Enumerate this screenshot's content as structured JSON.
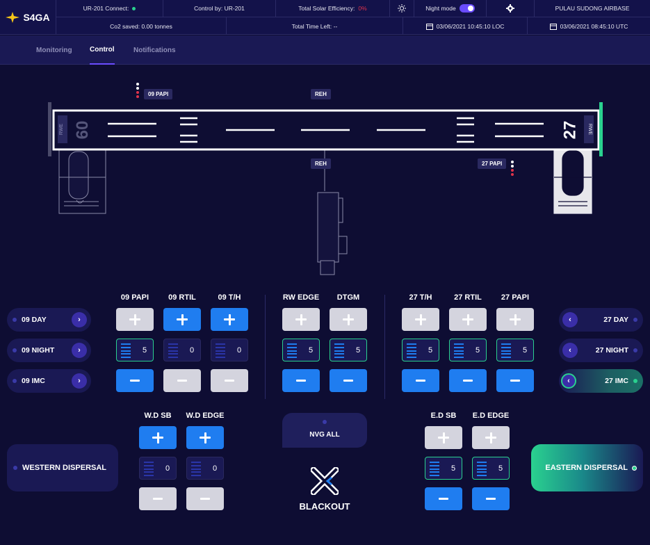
{
  "header": {
    "logo": "S4GA",
    "connect_label": "UR-201 Connect:",
    "control_by": "Control by: UR-201",
    "solar_label": "Total Solar Efficiency:",
    "solar_value": "0%",
    "night_mode_label": "Night mode",
    "airbase": "PULAU SUDONG AIRBASE",
    "co2": "Co2 saved: 0.00 tonnes",
    "time_left": "Total Time Left: --",
    "loc_time": "03/06/2021 10:45:10 LOC",
    "utc_time": "03/06/2021 08:45:10 UTC"
  },
  "tabs": [
    {
      "label": "Monitoring"
    },
    {
      "label": "Control"
    },
    {
      "label": "Notifications"
    }
  ],
  "runway": {
    "papi_09": "09 PAPI",
    "papi_27": "27 PAPI",
    "reh_top": "REH",
    "reh_bottom": "REH",
    "left_number": "09",
    "right_number": "27",
    "left_rwe": "RWE",
    "right_rwe": "RWE"
  },
  "left_modes": [
    {
      "label": "09 DAY"
    },
    {
      "label": "09 NIGHT"
    },
    {
      "label": "09 IMC"
    }
  ],
  "right_modes": [
    {
      "label": "27 DAY"
    },
    {
      "label": "27 NIGHT"
    },
    {
      "label": "27 IMC"
    }
  ],
  "groups": {
    "g09": [
      {
        "label": "09 PAPI",
        "value": "5"
      },
      {
        "label": "09 RTIL",
        "value": "0"
      },
      {
        "label": "09 T/H",
        "value": "0"
      }
    ],
    "center": [
      {
        "label": "RW EDGE",
        "value": "5"
      },
      {
        "label": "DTGM",
        "value": "5"
      }
    ],
    "g27": [
      {
        "label": "27 T/H",
        "value": "5"
      },
      {
        "label": "27 RTIL",
        "value": "5"
      },
      {
        "label": "27 PAPI",
        "value": "5"
      }
    ],
    "west": [
      {
        "label": "W.D SB",
        "value": "0"
      },
      {
        "label": "W.D EDGE",
        "value": "0"
      }
    ],
    "east": [
      {
        "label": "E.D SB",
        "value": "5"
      },
      {
        "label": "E.D EDGE",
        "value": "5"
      }
    ]
  },
  "western_dispersal": "WESTERN DISPERSAL",
  "eastern_dispersal": "EASTERN DISPERSAL",
  "nvg_all": "NVG ALL",
  "blackout": "BLACKOUT",
  "colors": {
    "accent": "#6a4cff",
    "blue": "#1f7df0",
    "green": "#2ad18f",
    "red": "#e0334a"
  }
}
